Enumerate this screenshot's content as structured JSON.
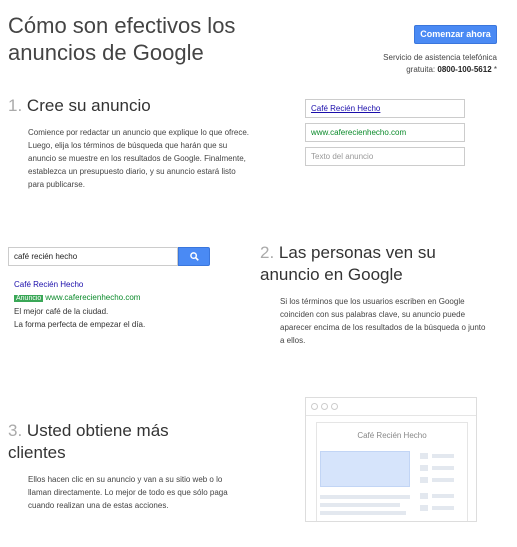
{
  "header": {
    "title": "Cómo son efectivos los anuncios de Google",
    "cta_label": "Comenzar ahora",
    "support_line1": "Servicio de asistencia telefónica",
    "support_line2_prefix": "gratuita: ",
    "support_phone": "0800-100-5612",
    "support_suffix": " *"
  },
  "steps": [
    {
      "number": "1.",
      "title": "Cree su anuncio",
      "description": "Comience por redactar un anuncio que explique lo que ofrece. Luego, elija los términos de búsqueda que harán que su anuncio se muestre en los resultados de Google. Finalmente, establezca un presupuesto diario, y su anuncio estará listo para publicarse."
    },
    {
      "number": "2.",
      "title": "Las personas ven su anuncio en Google",
      "description": "Si los términos que los usuarios escriben en Google coinciden con sus palabras clave, su anuncio puede aparecer encima de los resultados de la búsqueda o junto a ellos."
    },
    {
      "number": "3.",
      "title": "Usted obtiene más clientes",
      "description": "Ellos hacen clic en su anuncio y van a su sitio web o lo llaman directamente. Lo mejor de todo es que sólo paga cuando realizan una de estas acciones."
    }
  ],
  "ad_form": {
    "title_value": "Café Recién Hecho",
    "url_value": "www.caferecienhecho.com",
    "text_placeholder": "Texto del anuncio"
  },
  "search_demo": {
    "query": "café recién hecho",
    "search_icon": "magnifier-icon",
    "ad_title": "Café Recién Hecho",
    "ad_badge": "Anuncio",
    "ad_url": "www.caferecienhecho.com",
    "ad_line1": "El mejor café de la ciudad.",
    "ad_line2": "La forma perfecta de empezar el día."
  },
  "browser_demo": {
    "site_name": "Café Recién Hecho"
  },
  "colors": {
    "accent_blue": "#4a8af4",
    "link_blue": "#1a0dab",
    "url_green": "#0a8a2a",
    "badge_green": "#3aa757"
  }
}
